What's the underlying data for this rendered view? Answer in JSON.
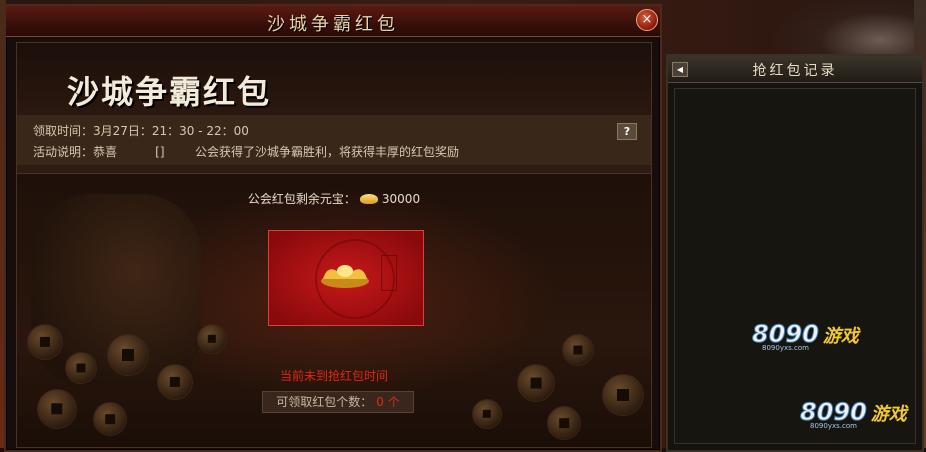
{
  "window": {
    "title": "沙城争霸红包",
    "close_label": "×"
  },
  "header": {
    "big_title": "沙城争霸红包",
    "time_line": "领取时间：3月27日：21：30 - 22：00",
    "desc_line": "活动说明：恭喜          []        公会获得了沙城争霸胜利，将获得丰厚的红包奖励",
    "help_label": "?"
  },
  "reward": {
    "balance_label": "公会红包剩余元宝：",
    "balance_value": "30000",
    "status_text": "当前未到抢红包时间",
    "count_label": "可领取红包个数：",
    "count_value": "0 个"
  },
  "side": {
    "title": "抢红包记录",
    "arrow_label": "◀"
  },
  "watermark": {
    "number": "8090",
    "text": "游戏",
    "site": "8090yxs.com"
  },
  "colors": {
    "envelope_red": "#c8181a",
    "status_red": "#e02818",
    "title_cream": "#f4ead8"
  },
  "icons": [
    "close-icon",
    "help-icon",
    "gold-ingot-icon",
    "arrow-left-icon"
  ]
}
